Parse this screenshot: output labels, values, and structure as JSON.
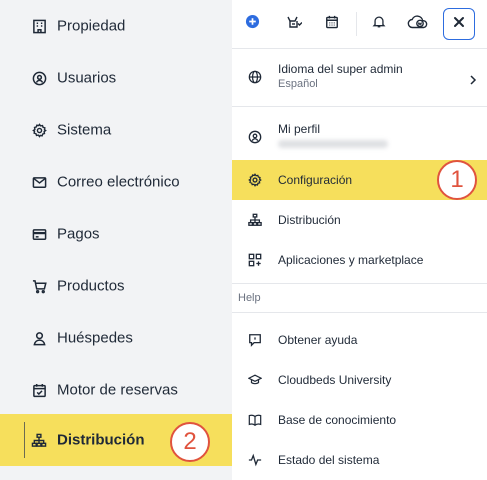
{
  "sidebar": {
    "items": [
      {
        "label": "Propiedad",
        "icon": "building-icon"
      },
      {
        "label": "Usuarios",
        "icon": "user-circle-icon"
      },
      {
        "label": "Sistema",
        "icon": "gear-icon"
      },
      {
        "label": "Correo electrónico",
        "icon": "mail-icon"
      },
      {
        "label": "Pagos",
        "icon": "credit-card-icon"
      },
      {
        "label": "Productos",
        "icon": "cart-icon"
      },
      {
        "label": "Huéspedes",
        "icon": "person-icon"
      },
      {
        "label": "Motor de reservas",
        "icon": "calendar-check-icon"
      },
      {
        "label": "Distribución",
        "icon": "sitemap-icon",
        "active": true
      }
    ]
  },
  "annotations": {
    "badge_1": "1",
    "badge_2": "2",
    "color": "#e0533e",
    "highlight": "#f6df5c"
  },
  "toolbar": {
    "icons": [
      "plus-circle-icon",
      "tasks-icon",
      "calendar-icon",
      "bell-icon",
      "cloud-w-icon",
      "close-icon"
    ],
    "accent": "#2d6cdf"
  },
  "menu": {
    "language": {
      "label": "Idioma del super admin",
      "value": "Español"
    },
    "profile": {
      "label": "Mi perfil"
    },
    "items": [
      {
        "label": "Configuración",
        "icon": "gear-icon",
        "active": true
      },
      {
        "label": "Distribución",
        "icon": "sitemap-icon"
      },
      {
        "label": "Aplicaciones y marketplace",
        "icon": "apps-plus-icon"
      }
    ],
    "help_section": "Help",
    "help_items": [
      {
        "label": "Obtener ayuda",
        "icon": "chat-icon"
      },
      {
        "label": "Cloudbeds University",
        "icon": "graduation-cap-icon"
      },
      {
        "label": "Base de conocimiento",
        "icon": "book-icon"
      },
      {
        "label": "Estado del sistema",
        "icon": "pulse-icon"
      }
    ]
  }
}
